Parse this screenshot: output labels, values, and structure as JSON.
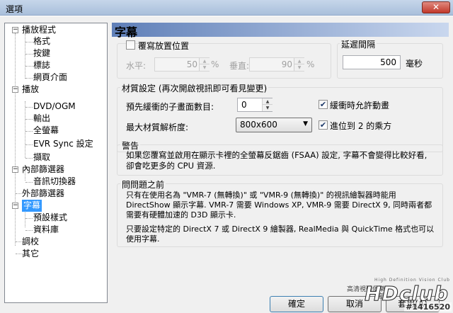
{
  "window": {
    "title": "選項",
    "close_label": "✕"
  },
  "tree": {
    "items": [
      {
        "label": "播放程式",
        "expander": "−"
      },
      {
        "label": "格式"
      },
      {
        "label": "按鍵"
      },
      {
        "label": "標誌"
      },
      {
        "label": "網頁介面"
      },
      {
        "label": "播放",
        "expander": "−"
      },
      {
        "label": "DVD/OGM"
      },
      {
        "label": "輸出"
      },
      {
        "label": "全螢幕"
      },
      {
        "label": "EVR Sync 設定"
      },
      {
        "label": "擷取"
      },
      {
        "label": "內部篩選器",
        "expander": "−"
      },
      {
        "label": "音訊切換器"
      },
      {
        "label": "外部篩選器"
      },
      {
        "label": "字幕",
        "expander": "−"
      },
      {
        "label": "預設樣式"
      },
      {
        "label": "資料庫"
      },
      {
        "label": "調校"
      },
      {
        "label": "其它"
      }
    ]
  },
  "page": {
    "title": "字幕"
  },
  "position_override": {
    "checkbox_label": "覆寫放置位置",
    "checked": false,
    "h_label": "水平:",
    "h_value": "50",
    "h_unit": "%",
    "v_label": "垂直:",
    "v_value": "90",
    "v_unit": "%"
  },
  "delay": {
    "title": "延遲間隔",
    "value": "500",
    "unit": "毫秒"
  },
  "texture": {
    "title": "材質設定 (再次開啟視訊即可看見變更)",
    "prebuffer_label": "預先緩衝的子畫面數目:",
    "prebuffer_value": "0",
    "max_res_label": "最大材質解析度:",
    "max_res_value": "800x600",
    "allow_anim_label": "緩衝時允許動畫",
    "allow_anim_checked": true,
    "round_pow2_label": "進位到 2 的乘方",
    "round_pow2_checked": true
  },
  "warning": {
    "title": "警告",
    "text": "如果您覆寫並啟用在顯示卡裡的全螢幕反鋸齒 (FSAA) 設定, 字幕不會變得比較好看, 卻會吃更多的 CPU 資源."
  },
  "faq": {
    "title": "問問題之前",
    "para1": "只有在使用名為 \"VMR-7 (無轉換)\" 或 \"VMR-9 (無轉換)\" 的視訊繪製器時能用 DirectShow 顯示字幕. VMR-7 需要 Windows XP, VMR-9 需要 DirectX 9, 同時兩者都需要有硬體加速的 D3D 顯示卡.",
    "para2": "只要設定特定的 DirectX 7 或 DirectX 9 繪製器, RealMedia 與 QuickTime 格式也可以使用字幕."
  },
  "buttons": {
    "ok": "確定",
    "cancel": "取消",
    "apply": "套用(A)"
  },
  "watermark": {
    "tagline": "High  Definition  Vision  Club",
    "cn": "高清視聽俱樂部",
    "logo": "HDclub",
    "sub": "#1416520"
  },
  "colors": {
    "header_start": "#5f7fb8",
    "header_end": "#c9d7ee"
  }
}
